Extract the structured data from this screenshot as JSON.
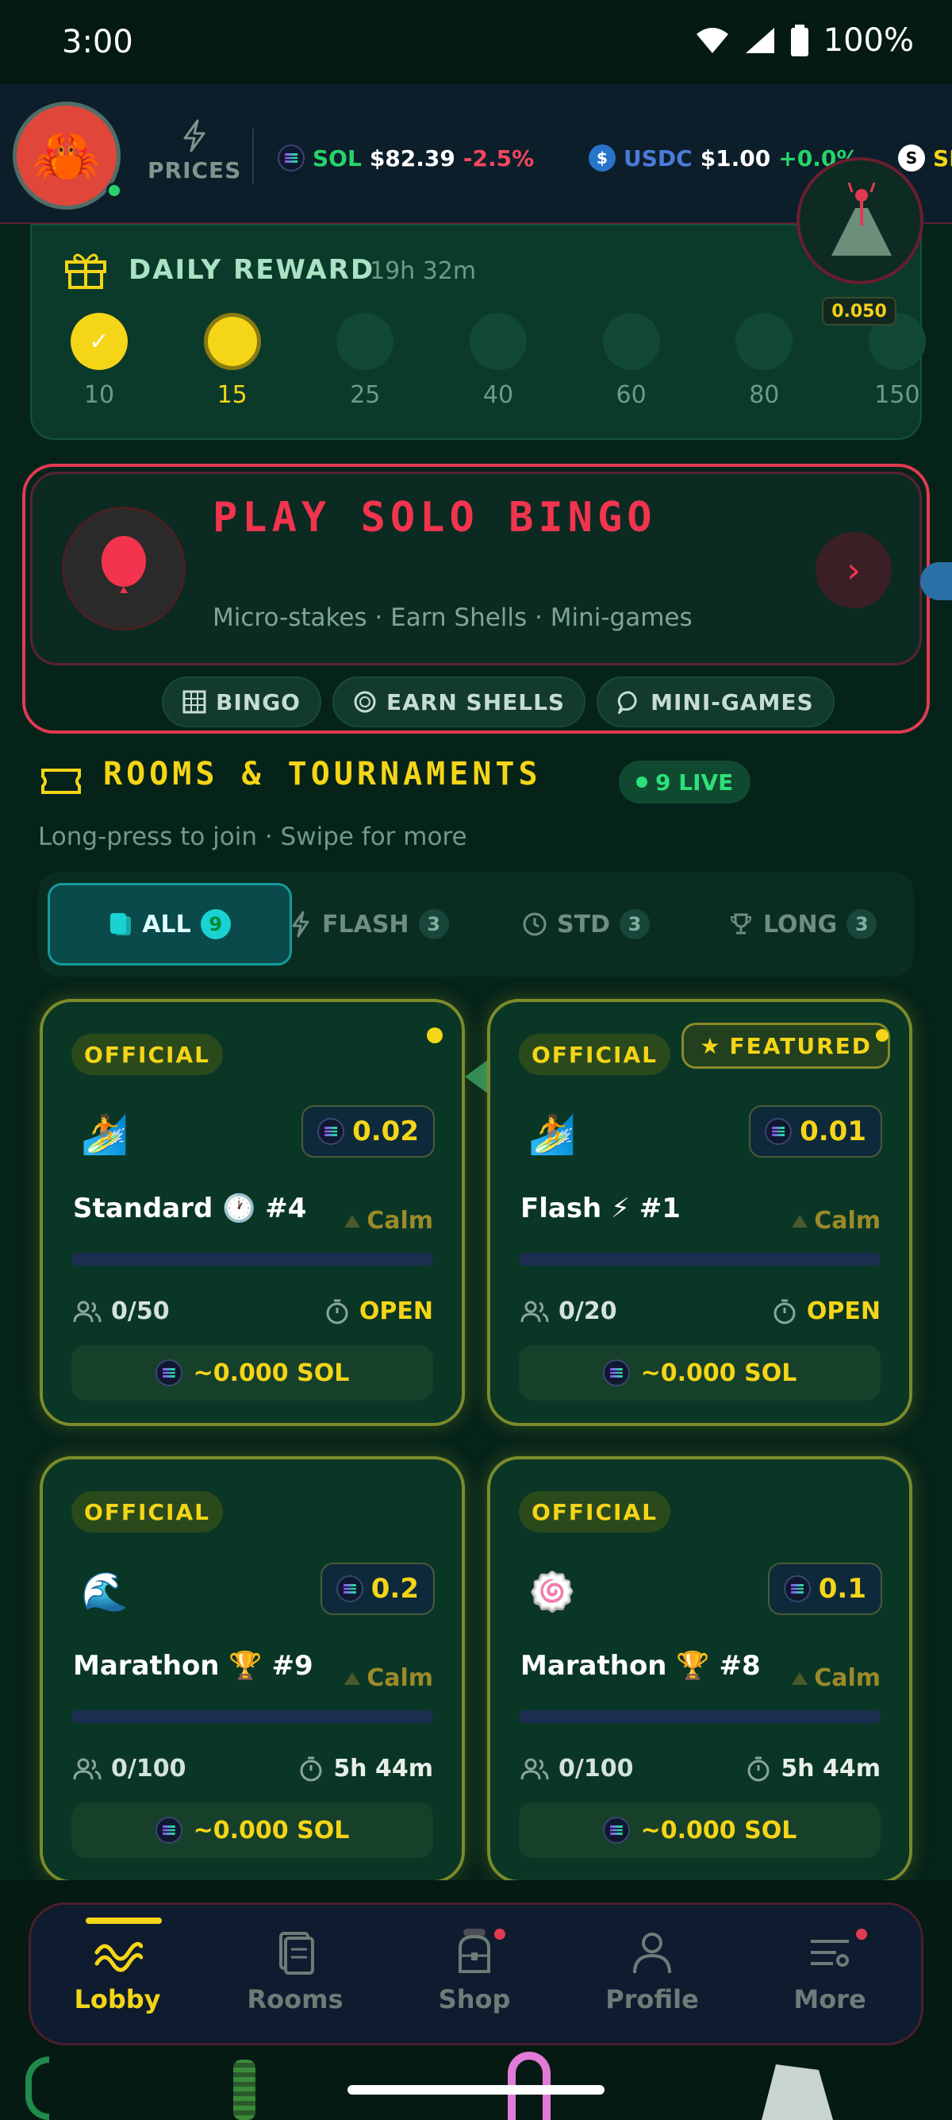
{
  "status_bar": {
    "time": "3:00",
    "battery": "100%"
  },
  "ticker": {
    "avatar_icon": "crab-icon",
    "prices_label": "PRICES",
    "items": [
      {
        "symbol": "SOL",
        "price": "$82.39",
        "change": "-2.5%",
        "symbol_color": "#27d46c"
      },
      {
        "symbol": "USDC",
        "price": "$1.00",
        "change": "+0.0%",
        "symbol_color": "#4a7bd8"
      },
      {
        "symbol": "SI",
        "price": "",
        "change": "",
        "symbol_color": "#f5d517"
      }
    ],
    "volcano_value": "0.050"
  },
  "daily_reward": {
    "title": "DAILY REWARD",
    "timer": "19h 32m",
    "steps": [
      {
        "amount": "10",
        "state": "claimed"
      },
      {
        "amount": "15",
        "state": "current"
      },
      {
        "amount": "25",
        "state": "locked"
      },
      {
        "amount": "40",
        "state": "locked"
      },
      {
        "amount": "60",
        "state": "locked"
      },
      {
        "amount": "80",
        "state": "locked"
      },
      {
        "amount": "150",
        "state": "locked"
      }
    ]
  },
  "solo": {
    "title": "PLAY SOLO BINGO",
    "subtitle": "Micro-stakes · Earn Shells · Mini-games",
    "arrow": "›",
    "pills": [
      {
        "label": "BINGO",
        "icon": "grid-icon"
      },
      {
        "label": "EARN SHELLS",
        "icon": "shell-icon"
      },
      {
        "label": "MINI-GAMES",
        "icon": "chat-icon"
      }
    ]
  },
  "rooms": {
    "title": "ROOMS & TOURNAMENTS",
    "live": "9 LIVE",
    "subtitle": "Long-press to join · Swipe for more",
    "tabs": [
      {
        "label": "ALL",
        "count": "9"
      },
      {
        "label": "FLASH",
        "count": "3"
      },
      {
        "label": "STD",
        "count": "3"
      },
      {
        "label": "LONG",
        "count": "3"
      }
    ],
    "cards": [
      {
        "badge": "OFFICIAL",
        "featured": "",
        "emoji": "🏄",
        "stake": "0.02",
        "name": "Standard 🕐 #4",
        "mood": "Calm",
        "fill": 0,
        "players": "0/50",
        "status": "OPEN",
        "pot": "~0.000 SOL"
      },
      {
        "badge": "OFFICIAL",
        "featured": "FEATURED",
        "emoji": "🏄",
        "stake": "0.01",
        "name": "Flash ⚡ #1",
        "mood": "Calm",
        "fill": 0,
        "players": "0/20",
        "status": "OPEN",
        "pot": "~0.000 SOL"
      },
      {
        "badge": "OFFICIAL",
        "featured": "",
        "emoji": "🌊",
        "stake": "0.2",
        "name": "Marathon 🏆 #9",
        "mood": "Calm",
        "fill": 0,
        "players": "0/100",
        "status": "5h 44m",
        "pot": "~0.000 SOL"
      },
      {
        "badge": "OFFICIAL",
        "featured": "",
        "emoji": "🍥",
        "stake": "0.1",
        "name": "Marathon 🏆 #8",
        "mood": "Calm",
        "fill": 0,
        "players": "0/100",
        "status": "5h 44m",
        "pot": "~0.000 SOL"
      }
    ]
  },
  "nav": [
    {
      "label": "Lobby",
      "active": true
    },
    {
      "label": "Rooms",
      "active": false
    },
    {
      "label": "Shop",
      "active": false
    },
    {
      "label": "Profile",
      "active": false
    },
    {
      "label": "More",
      "active": false
    }
  ],
  "colors": {
    "accent": "#f5d517",
    "danger": "#f2344e",
    "live": "#2ee07a",
    "bg": "#06231a"
  }
}
